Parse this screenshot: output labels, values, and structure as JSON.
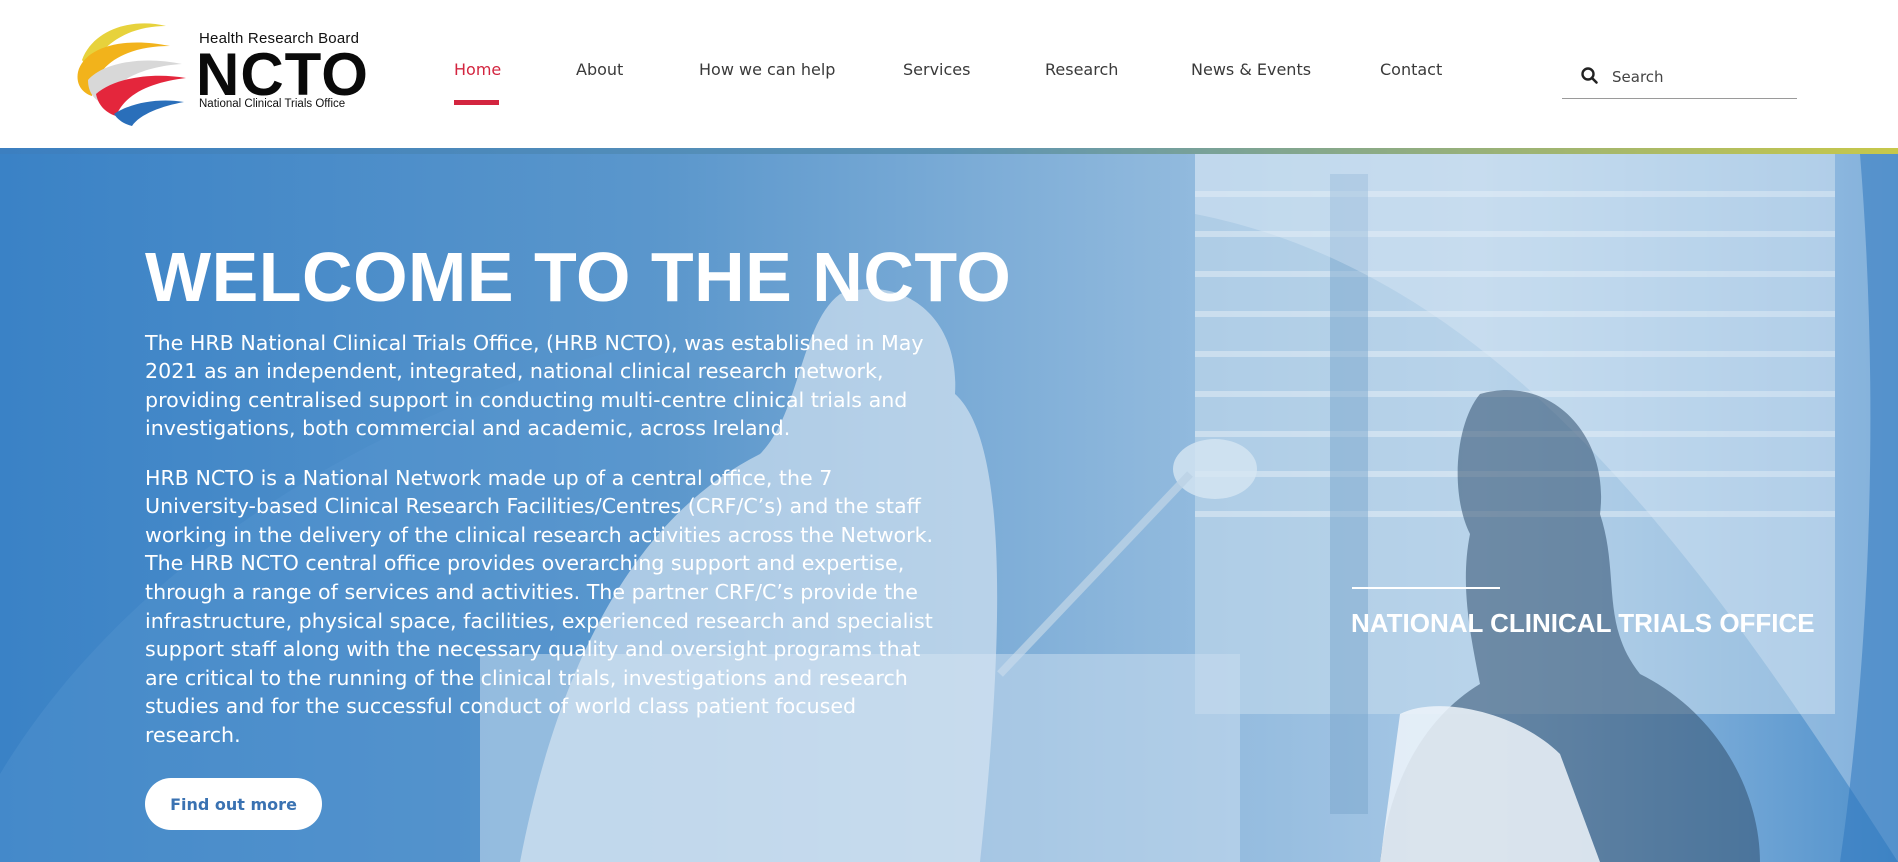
{
  "brand": {
    "org_name": "Health Research Board",
    "acronym": "NCTO",
    "full_name": "National Clinical Trials Office",
    "logo_colors": [
      "#f2c21b",
      "#e4263c",
      "#2a6fba",
      "#d9d9d9"
    ]
  },
  "nav": {
    "items": [
      {
        "label": "Home",
        "active": true
      },
      {
        "label": "About",
        "active": false
      },
      {
        "label": "How we can help",
        "active": false
      },
      {
        "label": "Services",
        "active": false
      },
      {
        "label": "Research",
        "active": false
      },
      {
        "label": "News & Events",
        "active": false
      },
      {
        "label": "Contact",
        "active": false
      }
    ],
    "active_color": "#d3253f"
  },
  "search": {
    "placeholder": "Search",
    "icon": "search-icon"
  },
  "hero": {
    "title": "WELCOME TO THE NCTO",
    "paragraph_1": "The HRB National Clinical Trials Office, (HRB NCTO), was established in May 2021 as an independent, integrated, national clinical research network, providing centralised support in conducting multi-centre clinical trials and investigations, both commercial and academic, across Ireland.",
    "paragraph_2": "HRB NCTO is a National Network made up of a central office, the 7 University-based Clinical Research Facilities/Centres (CRF/C’s) and the staff working in the delivery of the clinical research activities across the Network. The HRB NCTO central office provides overarching support and expertise, through a range of services and activities. The partner CRF/C’s provide the infrastructure, physical space, facilities, experienced research and specialist support staff along with the necessary quality and oversight programs that are critical to the running of the clinical trials, investigations and research studies and for the successful conduct of world class patient focused research.",
    "cta_label": "Find out more",
    "side_label": "NATIONAL CLINICAL TRIALS OFFICE",
    "overlay_color": "#3a82c6",
    "cta_text_color": "#3a72b2"
  }
}
